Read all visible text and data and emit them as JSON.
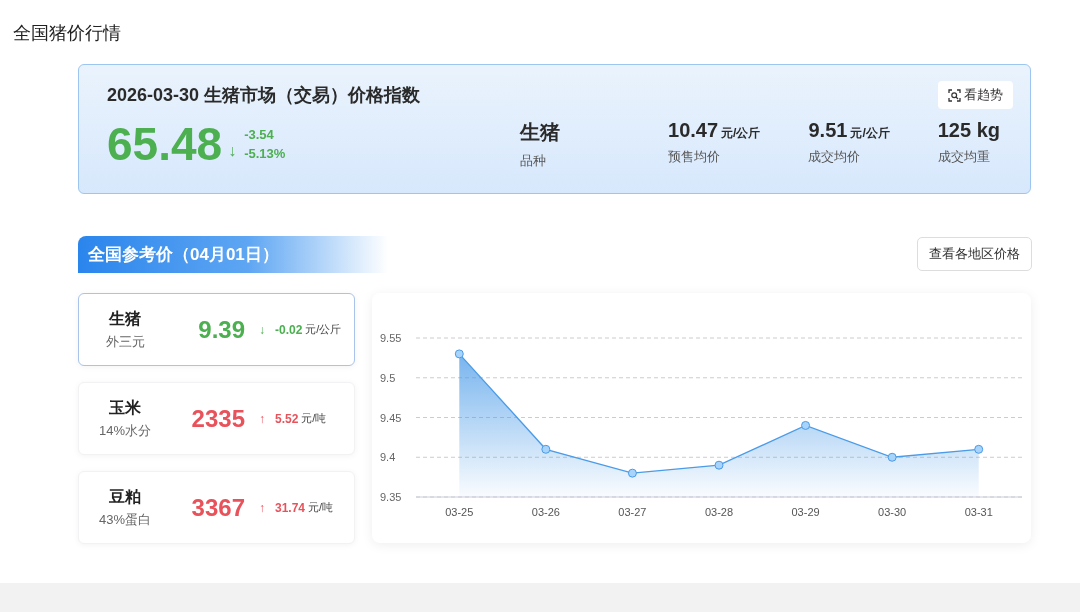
{
  "page_title": "全国猪价行情",
  "index": {
    "title": "2026-03-30 生猪市场（交易）价格指数",
    "value": "65.48",
    "color": "#4caf50",
    "arrow": "↓",
    "change": "-3.54",
    "change_pct": "-5.13%",
    "trend_button": "看趋势",
    "stats": [
      {
        "value": "生猪",
        "label": "品种"
      },
      {
        "value": "10.47",
        "unit": "元/公斤",
        "label": "预售均价"
      },
      {
        "value": "9.51",
        "unit": "元/公斤",
        "label": "成交均价"
      },
      {
        "value": "125 kg",
        "label": "成交均重"
      }
    ]
  },
  "reference": {
    "title": "全国参考价（04月01日）",
    "region_button": "查看各地区价格",
    "items": [
      {
        "name": "生猪",
        "spec": "外三元",
        "price": "9.39",
        "color": "#4caf50",
        "arrow": "↓",
        "change": "-0.02",
        "unit": "元/公斤",
        "selected": true
      },
      {
        "name": "玉米",
        "spec": "14%水分",
        "price": "2335",
        "color": "#e8525a",
        "arrow": "↑",
        "change": "5.52",
        "unit": "元/吨",
        "selected": false
      },
      {
        "name": "豆粕",
        "spec": "43%蛋白",
        "price": "3367",
        "color": "#e8525a",
        "arrow": "↑",
        "change": "31.74",
        "unit": "元/吨",
        "selected": false
      }
    ],
    "chart_data": {
      "type": "area",
      "grid": true,
      "categories": [
        "03-25",
        "03-26",
        "03-27",
        "03-28",
        "03-29",
        "03-30",
        "03-31"
      ],
      "series": [
        {
          "color": "#4a9be8",
          "values": [
            9.53,
            9.41,
            9.38,
            9.39,
            9.44,
            9.4,
            9.41
          ]
        }
      ],
      "ylim": [
        9.35,
        9.55
      ],
      "yticks": [
        9.35,
        {
          "value": 9.4,
          "label": "9.4"
        },
        9.45,
        {
          "value": 9.5,
          "label": "9.5"
        },
        9.55
      ]
    }
  }
}
